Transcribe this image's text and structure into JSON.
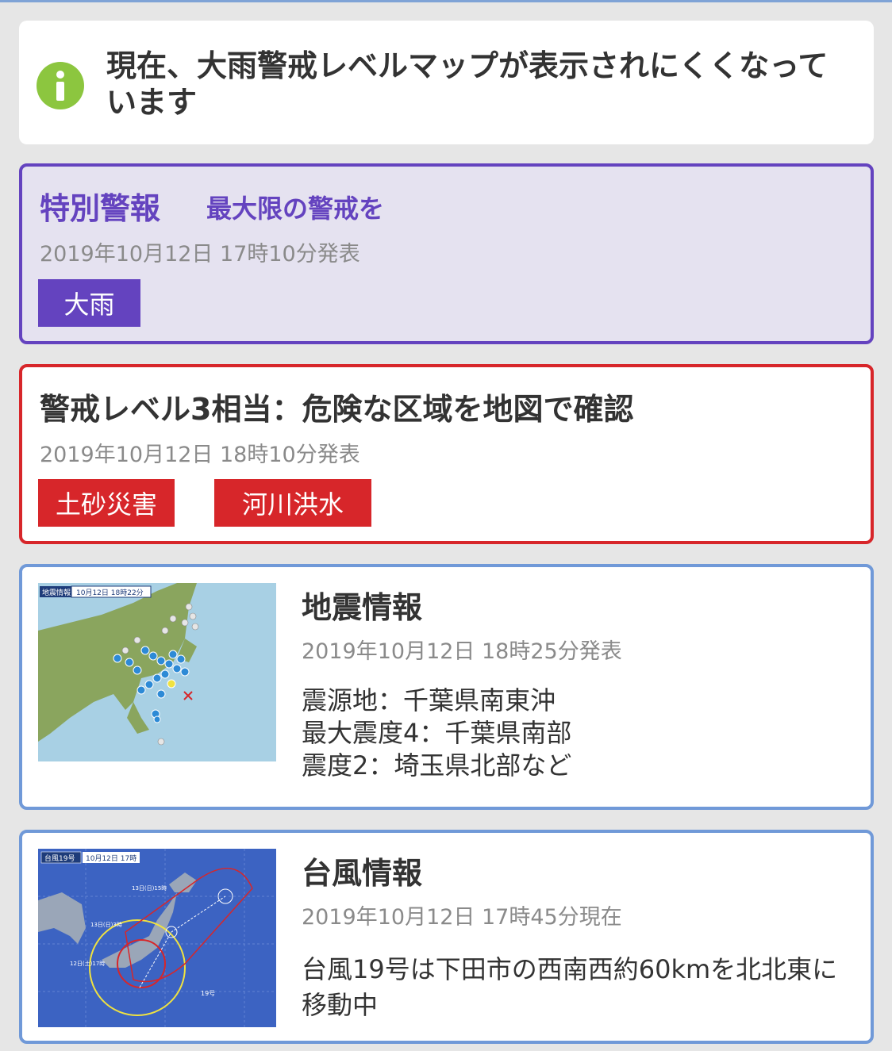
{
  "notice": {
    "icon": "info-icon",
    "text": "現在、大雨警戒レベルマップが表示されにくくなっています"
  },
  "special_warning": {
    "title": "特別警報",
    "subtitle": "最大限の警戒を",
    "date": "2019年10月12日 17時10分発表",
    "tags": [
      "大雨"
    ],
    "accent": "#6443bf"
  },
  "level3": {
    "title": "警戒レベル3相当：危険な区域を地図で確認",
    "date": "2019年10月12日 18時10分発表",
    "tags": [
      "土砂災害",
      "河川洪水"
    ],
    "accent": "#d7262a"
  },
  "earthquake": {
    "title": "地震情報",
    "date": "2019年10月12日 18時25分発表",
    "lines": [
      "震源地：千葉県南東沖",
      "最大震度4：千葉県南部",
      "震度2：埼玉県北部など"
    ],
    "map_label": "地震情報",
    "map_time": "10月12日 18時22分"
  },
  "typhoon": {
    "title": "台風情報",
    "date": "2019年10月12日 17時45分現在",
    "text": "台風19号は下田市の西南西約60kmを北北東に移動中",
    "map_label": "台風19号",
    "map_time": "10月12日 17時",
    "map_marks": [
      "13日(日)15時",
      "13日(日)3時",
      "12日(土)17時",
      "19号"
    ]
  }
}
